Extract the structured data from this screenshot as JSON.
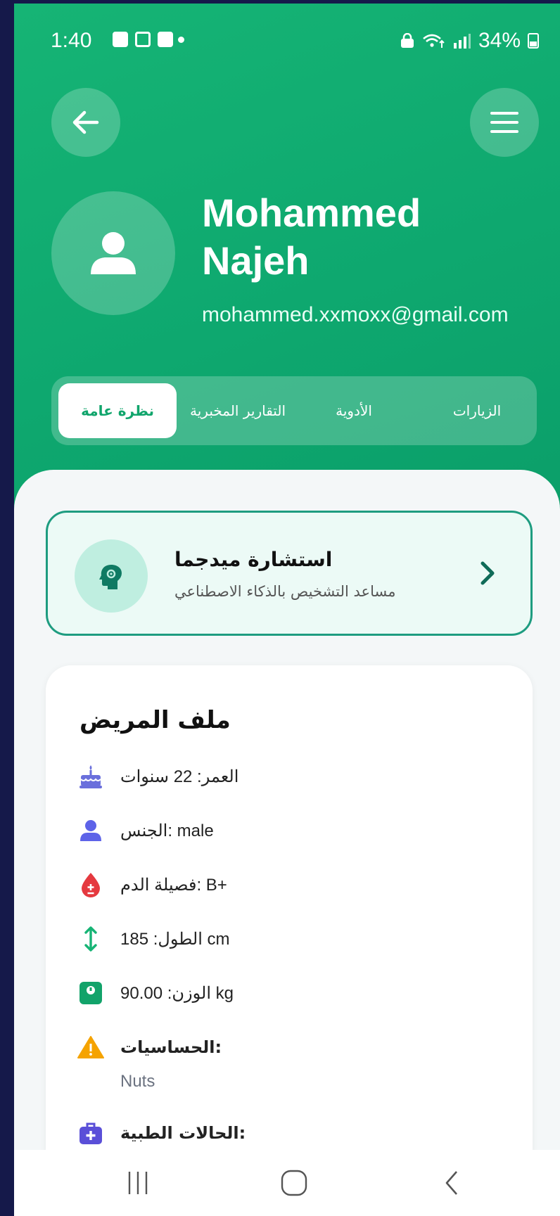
{
  "status_bar": {
    "time": "1:40",
    "battery": "34%"
  },
  "header": {
    "user_name_line1": "Mohammed",
    "user_name_line2": "Najeh",
    "email": "mohammed.xxmoxx@gmail.com"
  },
  "tabs": [
    {
      "label": "نظرة عامة",
      "active": true
    },
    {
      "label": "التقارير المخبرية",
      "active": false
    },
    {
      "label": "الأدوية",
      "active": false
    },
    {
      "label": "الزيارات",
      "active": false
    }
  ],
  "consult": {
    "title": "استشارة ميدجما",
    "subtitle": "مساعد التشخيص بالذكاء الاصطناعي"
  },
  "profile": {
    "title": "ملف المريض",
    "age": "العمر: 22 سنوات",
    "gender": "الجنس: male",
    "blood": "فصيلة الدم: B+",
    "height": "الطول: 185 cm",
    "weight": "الوزن: 90.00 kg",
    "allergies_label": "الحساسيات:",
    "allergies_value": "Nuts",
    "conditions_label": "الحالات الطبية:"
  },
  "colors": {
    "brand_green": "#0ea86f",
    "accent_teal": "#1e9c80",
    "age_icon": "#6a6fdc",
    "gender_icon": "#5d63e8",
    "blood_icon": "#e5393f",
    "height_icon": "#16b475",
    "weight_icon": "#12a36a",
    "allergy_icon": "#f5a300",
    "conditions_icon": "#5a4fd8"
  }
}
